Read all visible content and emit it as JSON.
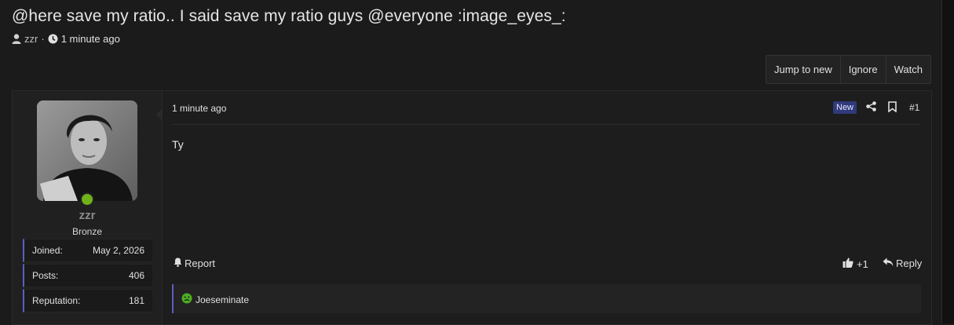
{
  "thread": {
    "title": "@here save my ratio.. I said save my ratio guys @everyone :image_eyes_:",
    "author": "zzr",
    "separator": "·",
    "time": "1 minute ago"
  },
  "actions": {
    "jump_to_new": "Jump to new",
    "ignore": "Ignore",
    "watch": "Watch"
  },
  "user": {
    "name": "zzr",
    "rank": "Bronze",
    "online": true,
    "stats": [
      {
        "label": "Joined:",
        "value": "May 2, 2026"
      },
      {
        "label": "Posts:",
        "value": "406"
      },
      {
        "label": "Reputation:",
        "value": "181"
      }
    ]
  },
  "post": {
    "time": "1 minute ago",
    "badge": "New",
    "number": "#1",
    "body": "Ty",
    "report_label": "Report",
    "like_count": "+1",
    "reply_label": "Reply",
    "reactor": "Joeseminate"
  },
  "colors": {
    "accent": "#5b5fbe",
    "online": "#6fb21a",
    "badge_bg": "#30397a",
    "reaction_icon": "#4caf22"
  },
  "icons": {
    "author": "user-icon",
    "time": "clock-icon",
    "share": "share-icon",
    "bookmark": "bookmark-icon",
    "report": "bell-icon",
    "like": "thumbs-up-icon",
    "reply": "reply-icon",
    "reaction": "sick-face-emoji-icon"
  }
}
